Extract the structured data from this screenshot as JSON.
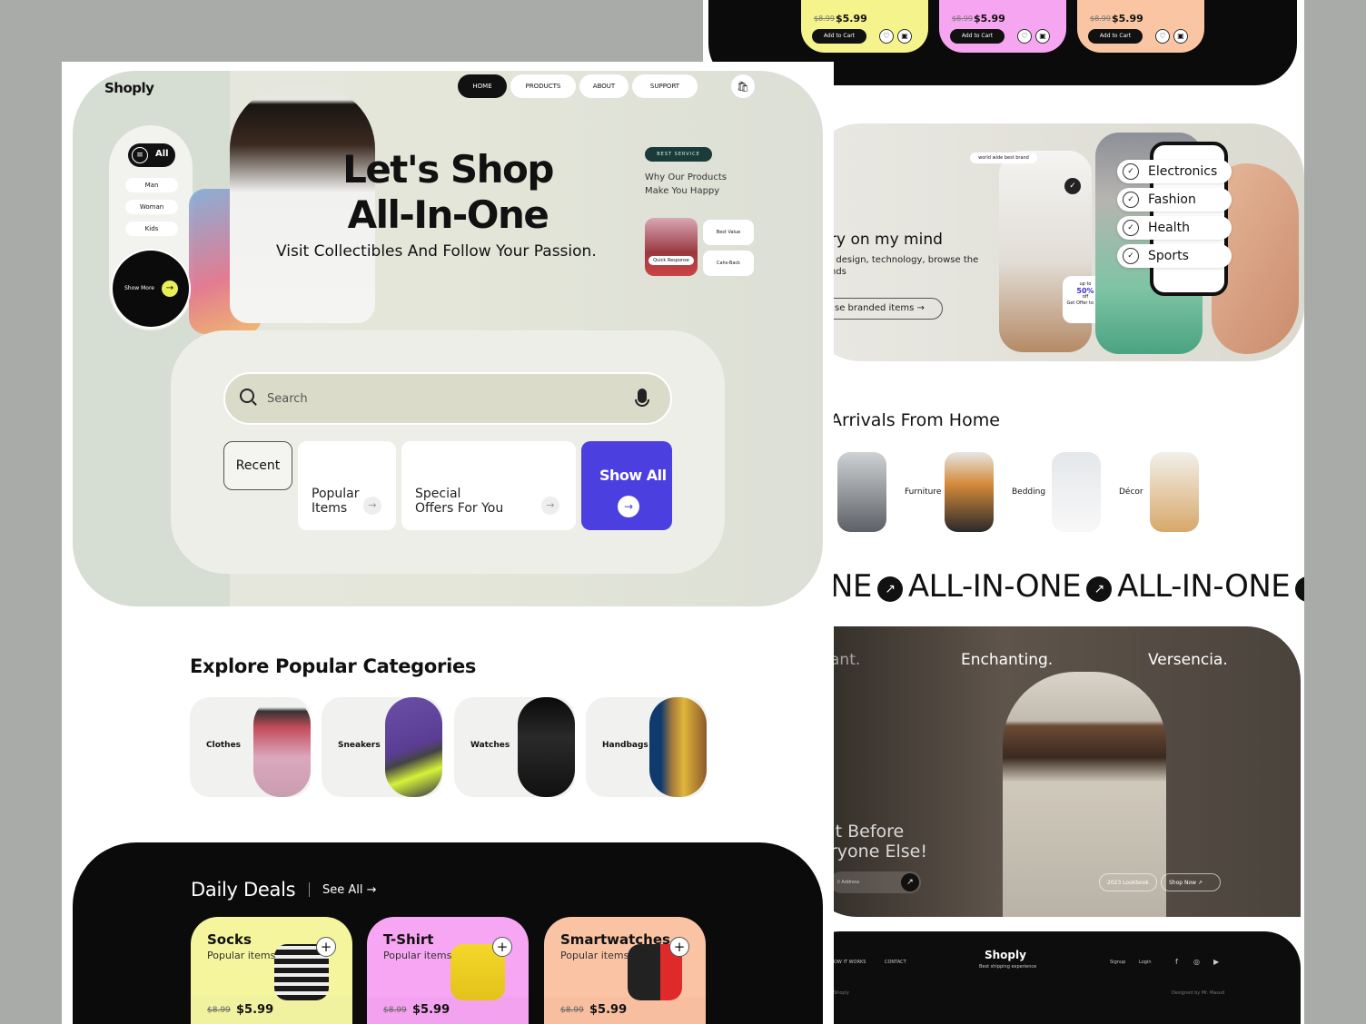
{
  "top_products": [
    {
      "old": "$8.99",
      "new": "$5.99",
      "add": "Add to Cart",
      "color": "#f4f38c"
    },
    {
      "old": "$8.99",
      "new": "$5.99",
      "add": "Add to Cart",
      "color": "#f6a5f0"
    },
    {
      "old": "$8.99",
      "new": "$5.99",
      "add": "Add to Cart",
      "color": "#f9c5a2"
    }
  ],
  "promo": {
    "title": "ry on my mind",
    "desc": ", design, technology, browse the nds",
    "button": "se branded items",
    "tag": "world wide best brand",
    "offer_up": "up to",
    "offer_pct": "50%",
    "offer_off": "off",
    "offer_note": "Get Offer to Day",
    "categories": [
      "Electronics",
      "Fashion",
      "Health",
      "Sports"
    ]
  },
  "arrivals": {
    "title": "Arrivals From Home",
    "items": [
      "Furniture",
      "Bedding",
      "Décor"
    ]
  },
  "marquee": [
    "NE",
    "ALL-IN-ONE",
    "ALL-IN-ONE"
  ],
  "lookbook": {
    "words": [
      "ant.",
      "Enchanting.",
      "Versencia."
    ],
    "cta1": "It Before",
    "cta2": "ryone Else!",
    "email": "il Address",
    "btn1": "2023 Lookbook",
    "btn2": "Shop Now"
  },
  "footer": {
    "logo": "Shoply",
    "tagline": "Best shipping experience",
    "links": [
      "OW IT WORKS",
      "CONTACT"
    ],
    "signup": "Signup",
    "login": "Login",
    "copy": "Shoply",
    "credit": "Designed by Mr. Masud"
  },
  "brand": "Shoply",
  "nav": {
    "home": "HOME",
    "products": "PRODUCTS",
    "about": "ABOUT",
    "support": "SUPPORT"
  },
  "sidebar": {
    "all": "All",
    "items": [
      "Man",
      "Woman",
      "Kids"
    ],
    "show_more": "Show More"
  },
  "hero": {
    "headline1": "Let's Shop",
    "headline2": "All-In-One",
    "subhead": "Visit Collectibles And Follow Your Passion.",
    "badge": "BEST SERVICE",
    "why1": "Why Our Products",
    "why2": "Make You Happy",
    "quick": "Quick Response",
    "best_value": "Best Value",
    "cashback": "Cahs-Back"
  },
  "search": {
    "placeholder": "Search",
    "recent": "Recent",
    "popular1": "Popular",
    "popular2": "Items",
    "special1": "Special",
    "special2": "Offers For You",
    "show_all": "Show All",
    "accent": "#4c3fe0"
  },
  "categories": {
    "title": "Explore Popular Categories",
    "items": [
      "Clothes",
      "Sneakers",
      "Watches",
      "Handbags"
    ]
  },
  "deals": {
    "title": "Daily Deals",
    "see_all": "See All",
    "items": [
      {
        "title": "Socks",
        "sub": "Popular items",
        "old": "$8.99",
        "new": "$5.99",
        "color": "#f4f59c"
      },
      {
        "title": "T-Shirt",
        "sub": "Popular items",
        "old": "$8.99",
        "new": "$5.99",
        "color": "#f7a6f3"
      },
      {
        "title": "Smartwatches",
        "sub": "Popular items",
        "old": "$8.99",
        "new": "$5.99",
        "color": "#f9c3a4"
      }
    ]
  }
}
